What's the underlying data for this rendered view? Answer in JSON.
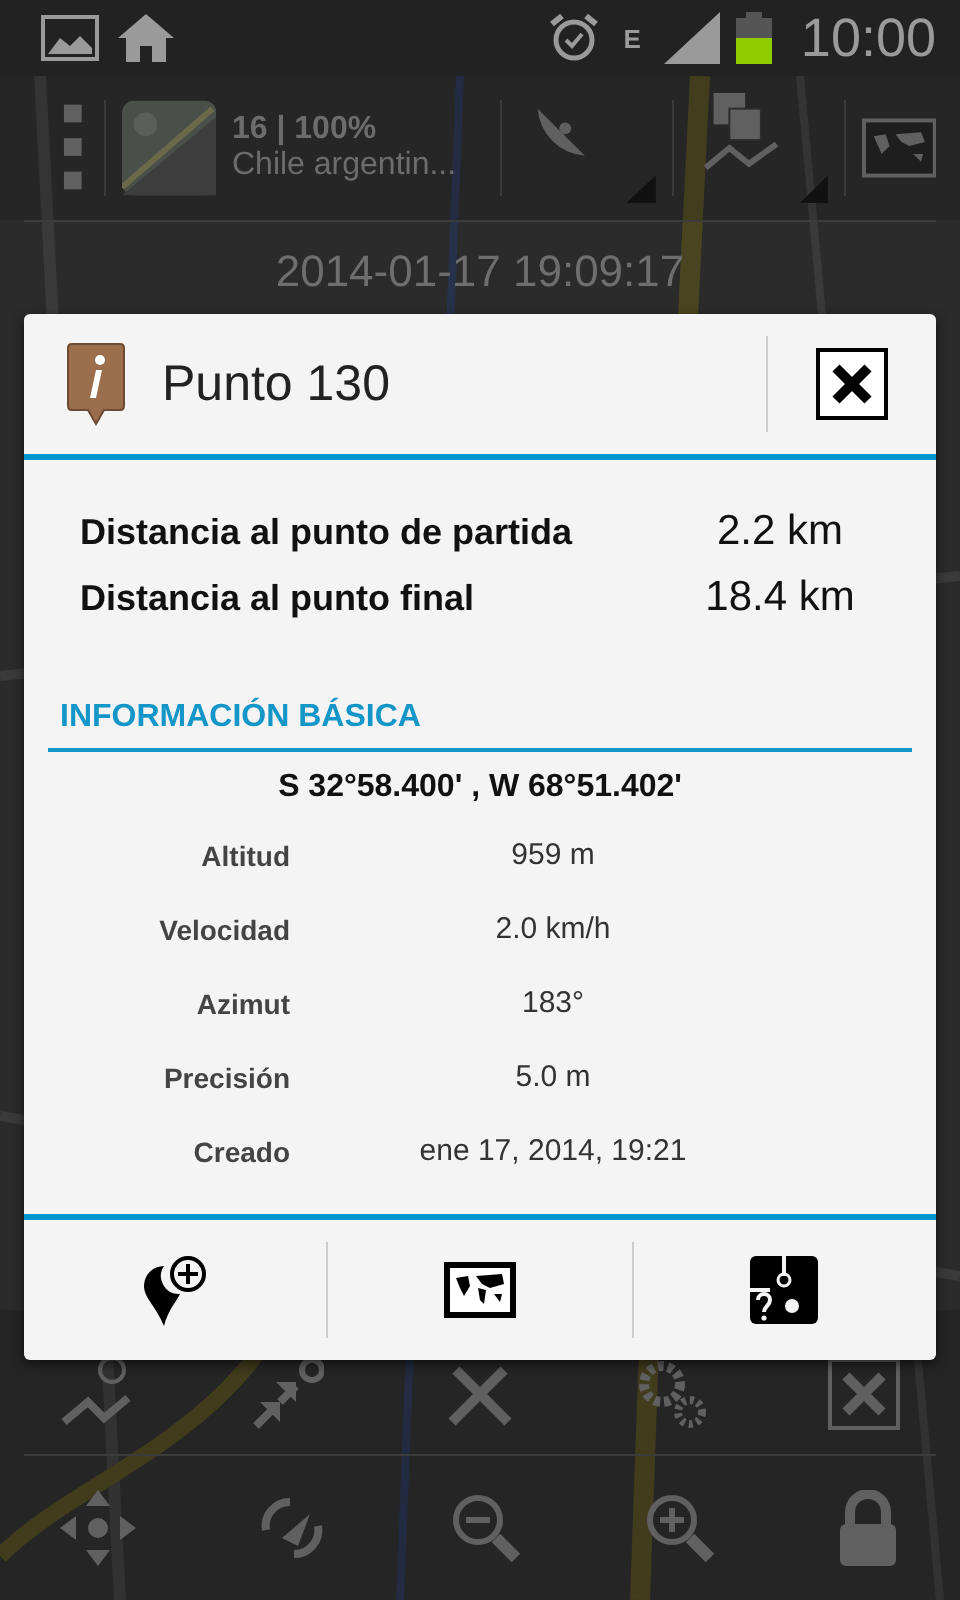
{
  "status_bar": {
    "network": "E",
    "time": "10:00"
  },
  "toolbar": {
    "zoom_battery": "16 | 100%",
    "map_name": "Chile argentin..."
  },
  "timestamp": "2014-01-17 19:09:17",
  "dialog": {
    "title": "Punto 130",
    "distances": [
      {
        "label": "Distancia al punto de partida",
        "value": "2.2 km"
      },
      {
        "label": "Distancia al punto final",
        "value": "18.4 km"
      }
    ],
    "section": "INFORMACIÓN BÁSICA",
    "coordinates": "S 32°58.400' , W 68°51.402'",
    "details": [
      {
        "label": "Altitud",
        "value": "959 m"
      },
      {
        "label": "Velocidad",
        "value": "2.0 km/h"
      },
      {
        "label": "Azimut",
        "value": "183°"
      },
      {
        "label": "Precisión",
        "value": "5.0 m"
      },
      {
        "label": "Creado",
        "value": "ene 17, 2014, 19:21"
      }
    ]
  }
}
